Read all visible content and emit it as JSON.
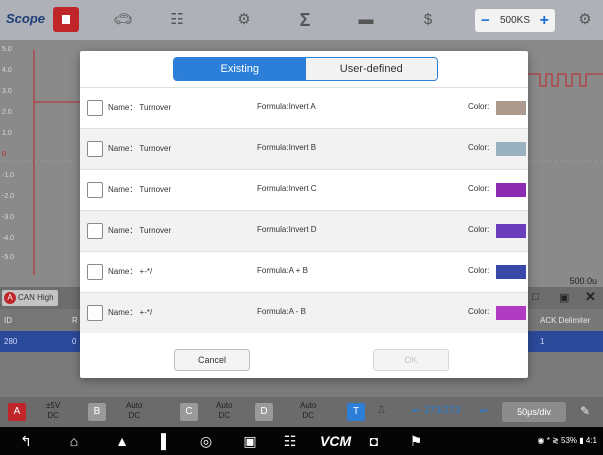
{
  "toolbar": {
    "logo": "Scope",
    "timebase": "500KS",
    "icons": [
      "stop-icon",
      "car-icon",
      "calendar-icon",
      "gear-icon",
      "sigma-icon",
      "folder-icon",
      "help-icon",
      "settings-icon"
    ]
  },
  "plot": {
    "y_labels": [
      "5.0",
      "4.0",
      "3.0",
      "2.0",
      "1.0",
      "0",
      "-1.0",
      "-2.0",
      "-3.0",
      "-4.0",
      "-5.0"
    ],
    "right_value": "500.0u"
  },
  "can": {
    "tag": "CAN High",
    "header_left": "ID",
    "header_r": "R",
    "header_right": "ACK Delimiter",
    "row_left": "280",
    "row_mid": "0",
    "row_right": "1"
  },
  "channels": {
    "a_label": "A",
    "a_value": "±5V",
    "a_coupling": "DC",
    "b_label": "B",
    "b_value": "Auto",
    "b_coupling": "DC",
    "c_label": "C",
    "c_value": "Auto",
    "c_coupling": "DC",
    "d_label": "D",
    "d_value": "Auto",
    "d_coupling": "DC",
    "t_label": "T",
    "page": "273/273",
    "time_div": "50μs/div"
  },
  "navbar": {
    "status": "◉ * ≷ 53% ▮ 4:1"
  },
  "dialog": {
    "tabs": {
      "existing": "Existing",
      "user_defined": "User-defined"
    },
    "rows": [
      {
        "name": "Name： Turnover",
        "formula": "Formula:Invert A",
        "color_label": "Color:",
        "swatch": "#ad9a8e"
      },
      {
        "name": "Name： Turnover",
        "formula": "Formula:Invert B",
        "color_label": "Color:",
        "swatch": "#9ab1bf"
      },
      {
        "name": "Name： Turnover",
        "formula": "Formula:Invert C",
        "color_label": "Color:",
        "swatch": "#8b2bb0"
      },
      {
        "name": "Name： Turnover",
        "formula": "Formula:Invert D",
        "color_label": "Color:",
        "swatch": "#6a3dbd"
      },
      {
        "name": "Name： +-*/",
        "formula": "Formula:A + B",
        "color_label": "Color:",
        "swatch": "#3847a8"
      },
      {
        "name": "Name： +-*/",
        "formula": "Formula:A - B",
        "color_label": "Color:",
        "swatch": "#b13bc2"
      }
    ],
    "cancel": "Cancel",
    "ok": "OK"
  }
}
